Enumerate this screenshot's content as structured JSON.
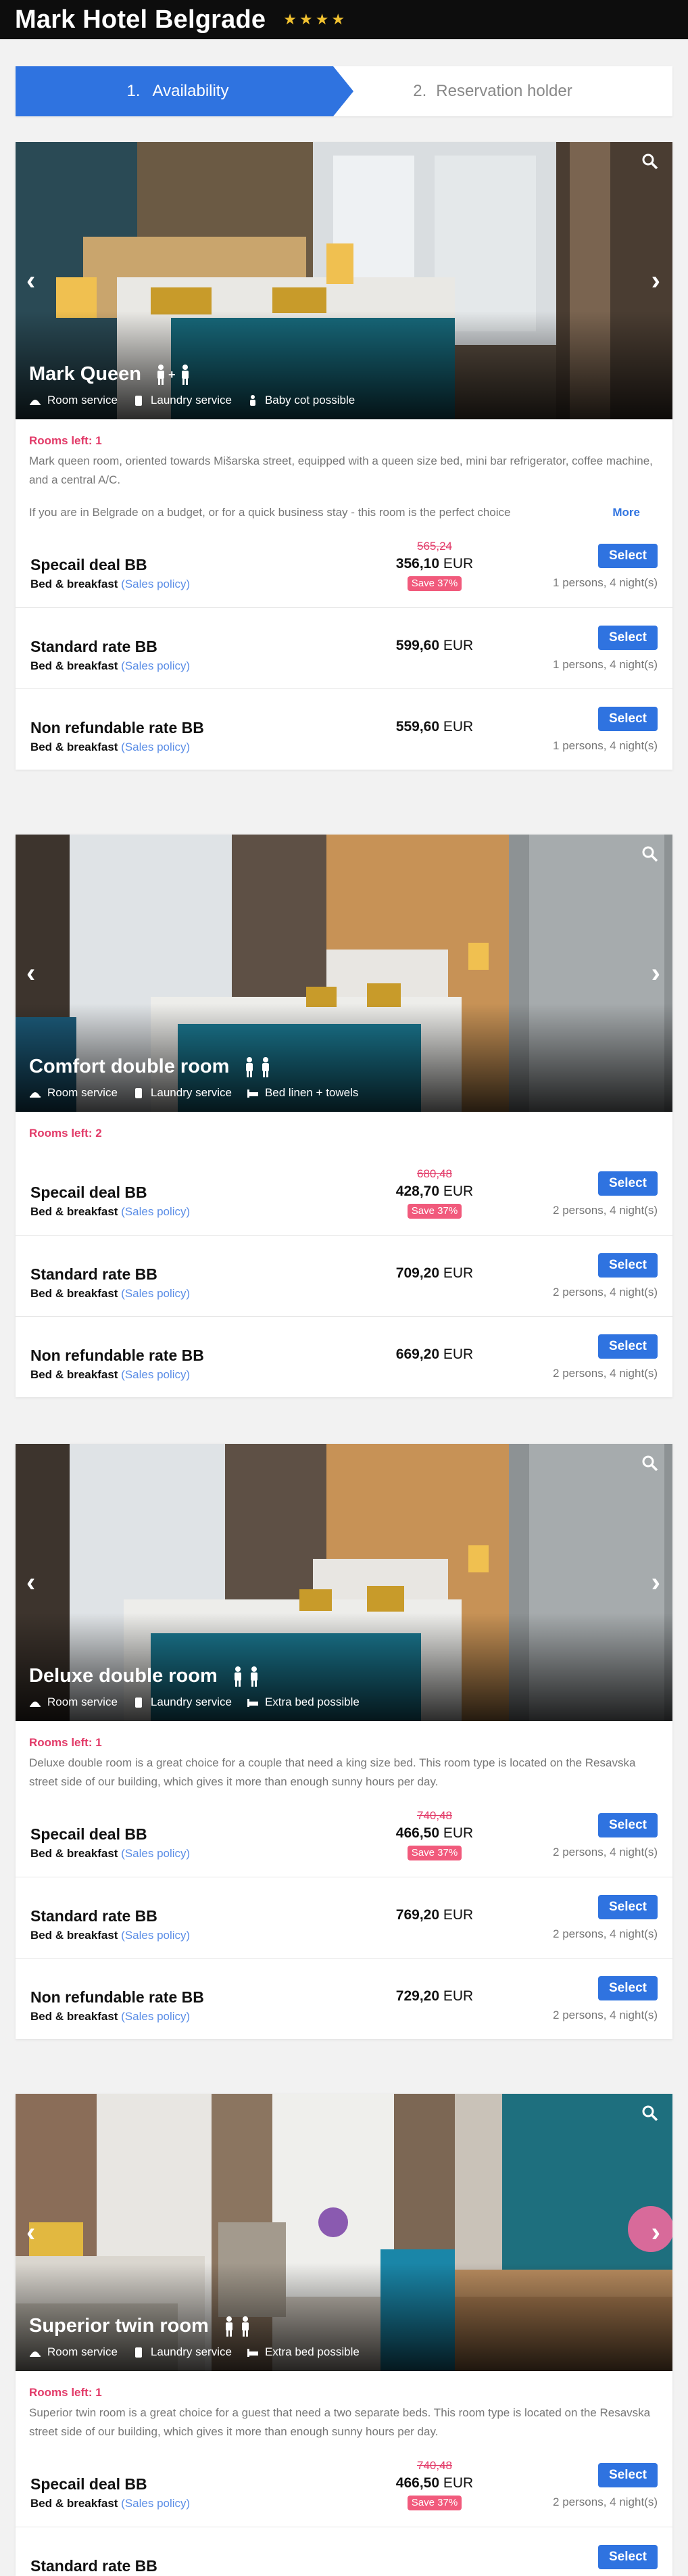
{
  "header": {
    "title": "Mark Hotel Belgrade",
    "stars": "★★★★"
  },
  "steps": [
    {
      "num": "1.",
      "label": "Availability"
    },
    {
      "num": "2.",
      "label": "Reservation holder"
    }
  ],
  "rooms": [
    {
      "name": "Mark Queen",
      "persons_icon": "👤+👤",
      "amenities": [
        "Room service",
        "Laundry service",
        "Baby cot possible"
      ],
      "amenity_icons": [
        "bell-icon",
        "laundry-icon",
        "baby-icon"
      ],
      "rooms_left": "Rooms left: 1",
      "desc": "Mark queen room, oriented towards Mišarska street, equipped with a queen size bed, mini bar refrigerator, coffee machine, and a central A/C.",
      "desc2": "If you are in Belgrade on a budget, or for a quick business stay - this room is the perfect choice",
      "more": "More",
      "rates": [
        {
          "name": "Specail deal BB",
          "board": "Bed & breakfast",
          "policy": "(Sales policy)",
          "old": "565,24",
          "price": "356,10",
          "cur": "EUR",
          "save": "Save 37%",
          "persons": "1 persons, 4 night(s)",
          "select": "Select"
        },
        {
          "name": "Standard rate BB",
          "board": "Bed & breakfast",
          "policy": "(Sales policy)",
          "price": "599,60",
          "cur": "EUR",
          "persons": "1 persons, 4 night(s)",
          "select": "Select"
        },
        {
          "name": "Non refundable rate BB",
          "board": "Bed & breakfast",
          "policy": "(Sales policy)",
          "price": "559,60",
          "cur": "EUR",
          "persons": "1 persons, 4 night(s)",
          "select": "Select"
        }
      ]
    },
    {
      "name": "Comfort double room",
      "persons_icon": "👤👤",
      "amenities": [
        "Room service",
        "Laundry service",
        "Bed linen + towels"
      ],
      "amenity_icons": [
        "bell-icon",
        "laundry-icon",
        "bed-icon"
      ],
      "rooms_left": "Rooms left: 2",
      "rates": [
        {
          "name": "Specail deal BB",
          "board": "Bed & breakfast",
          "policy": "(Sales policy)",
          "old": "680,48",
          "price": "428,70",
          "cur": "EUR",
          "save": "Save 37%",
          "persons": "2 persons, 4 night(s)",
          "select": "Select"
        },
        {
          "name": "Standard rate BB",
          "board": "Bed & breakfast",
          "policy": "(Sales policy)",
          "price": "709,20",
          "cur": "EUR",
          "persons": "2 persons, 4 night(s)",
          "select": "Select"
        },
        {
          "name": "Non refundable rate BB",
          "board": "Bed & breakfast",
          "policy": "(Sales policy)",
          "price": "669,20",
          "cur": "EUR",
          "persons": "2 persons, 4 night(s)",
          "select": "Select"
        }
      ]
    },
    {
      "name": "Deluxe double room",
      "persons_icon": "👤👤",
      "amenities": [
        "Room service",
        "Laundry service",
        "Extra bed possible"
      ],
      "amenity_icons": [
        "bell-icon",
        "laundry-icon",
        "bed-icon"
      ],
      "rooms_left": "Rooms left: 1",
      "desc": "Deluxe double room is a great choice for a couple that need a king size bed. This room type is located on the Resavska street side of our building, which gives it more than enough sunny hours per day.",
      "rates": [
        {
          "name": "Specail deal BB",
          "board": "Bed & breakfast",
          "policy": "(Sales policy)",
          "old": "740,48",
          "price": "466,50",
          "cur": "EUR",
          "save": "Save 37%",
          "persons": "2 persons, 4 night(s)",
          "select": "Select"
        },
        {
          "name": "Standard rate BB",
          "board": "Bed & breakfast",
          "policy": "(Sales policy)",
          "price": "769,20",
          "cur": "EUR",
          "persons": "2 persons, 4 night(s)",
          "select": "Select"
        },
        {
          "name": "Non refundable rate BB",
          "board": "Bed & breakfast",
          "policy": "(Sales policy)",
          "price": "729,20",
          "cur": "EUR",
          "persons": "2 persons, 4 night(s)",
          "select": "Select"
        }
      ]
    },
    {
      "name": "Superior twin room",
      "persons_icon": "👤👤",
      "amenities": [
        "Room service",
        "Laundry service",
        "Extra bed possible"
      ],
      "amenity_icons": [
        "bell-icon",
        "laundry-icon",
        "bed-icon"
      ],
      "rooms_left": "Rooms left: 1",
      "desc": "Superior twin room is a great choice for a guest that need a two separate beds. This room type is located on the Resavska street side of our building, which gives it more than enough sunny hours per day.",
      "rates": [
        {
          "name": "Specail deal BB",
          "board": "Bed & breakfast",
          "policy": "(Sales policy)",
          "old": "740,48",
          "price": "466,50",
          "cur": "EUR",
          "save": "Save 37%",
          "persons": "2 persons, 4 night(s)",
          "select": "Select"
        },
        {
          "name": "Standard rate BB",
          "board": "",
          "policy": "",
          "price": "",
          "cur": "",
          "persons": "",
          "select": "Select"
        }
      ]
    }
  ]
}
